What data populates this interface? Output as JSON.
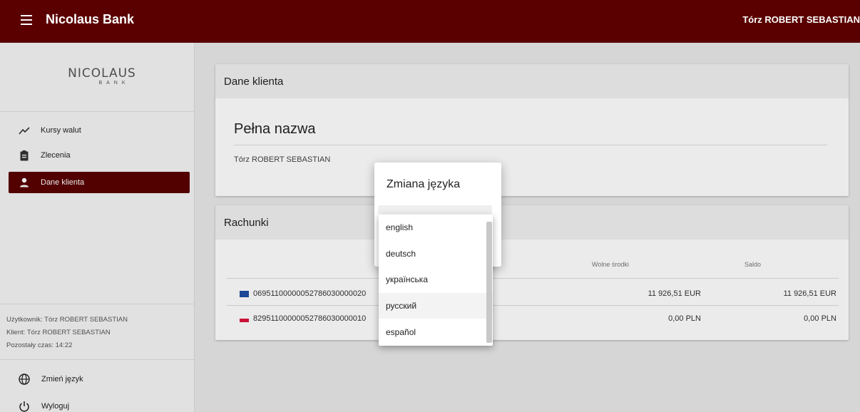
{
  "header": {
    "app_title": "Nicolaus Bank",
    "user_name": "Tórz ROBERT SEBASTIAN"
  },
  "sidebar": {
    "logo": {
      "line1": "NICOLAUS",
      "line2": "BANK"
    },
    "items": [
      {
        "label": "Kursy walut",
        "icon": "trending-up-icon",
        "active": false
      },
      {
        "label": "Zlecenia",
        "icon": "clipboard-icon",
        "active": false
      },
      {
        "label": "Dane klienta",
        "icon": "person-icon",
        "active": true
      }
    ],
    "info": {
      "user": "Użytkownik: Tórz ROBERT SEBASTIAN",
      "client": "Klient: Tórz ROBERT SEBASTIAN",
      "time_left": "Pozostały czas: 14:22"
    },
    "change_language": "Zmień język",
    "logout": "Wyloguj"
  },
  "main": {
    "client_card": {
      "header": "Dane klienta",
      "full_name_label": "Pełna nazwa",
      "full_name_value": "Tórz ROBERT SEBASTIAN"
    },
    "accounts_card": {
      "header": "Rachunki",
      "columns": {
        "free_funds": "Wolne środki",
        "balance": "Saldo"
      },
      "rows": [
        {
          "account": "06951100000052786030000020",
          "flag": "eu-flag-icon",
          "free_funds": "11 926,51 EUR",
          "balance": "11 926,51 EUR"
        },
        {
          "account": "82951100000052786030000010",
          "flag": "pl-flag-icon",
          "free_funds": "0,00 PLN",
          "balance": "0,00 PLN"
        }
      ]
    }
  },
  "dialog": {
    "title": "Zmiana języka",
    "options": [
      "english",
      "deutsch",
      "українська",
      "русский",
      "español"
    ],
    "highlighted_option": "русский"
  },
  "colors": {
    "brand": "#5a0000",
    "eu_flag": "#1f4fa3",
    "pl_flag_red": "#dc143c"
  }
}
